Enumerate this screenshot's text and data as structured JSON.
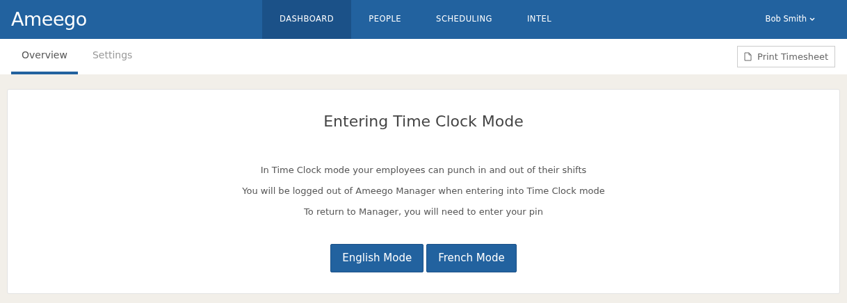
{
  "brand": "Ameego",
  "nav": [
    {
      "label": "DASHBOARD",
      "selected": true
    },
    {
      "label": "PEOPLE",
      "selected": false
    },
    {
      "label": "SCHEDULING",
      "selected": false
    },
    {
      "label": "INTEL",
      "selected": false
    }
  ],
  "user": {
    "name": "Bob Smith"
  },
  "tabs": [
    {
      "label": "Overview",
      "selected": true
    },
    {
      "label": "Settings",
      "selected": false
    }
  ],
  "print_button": "Print Timesheet",
  "card": {
    "title": "Entering Time Clock Mode",
    "lines": [
      "In Time Clock mode your employees can punch in and out of their shifts",
      "You will be logged out of Ameego Manager when entering into Time Clock mode",
      "To return to Manager, you will need to enter your pin"
    ],
    "buttons": [
      "English Mode",
      "French Mode"
    ]
  }
}
